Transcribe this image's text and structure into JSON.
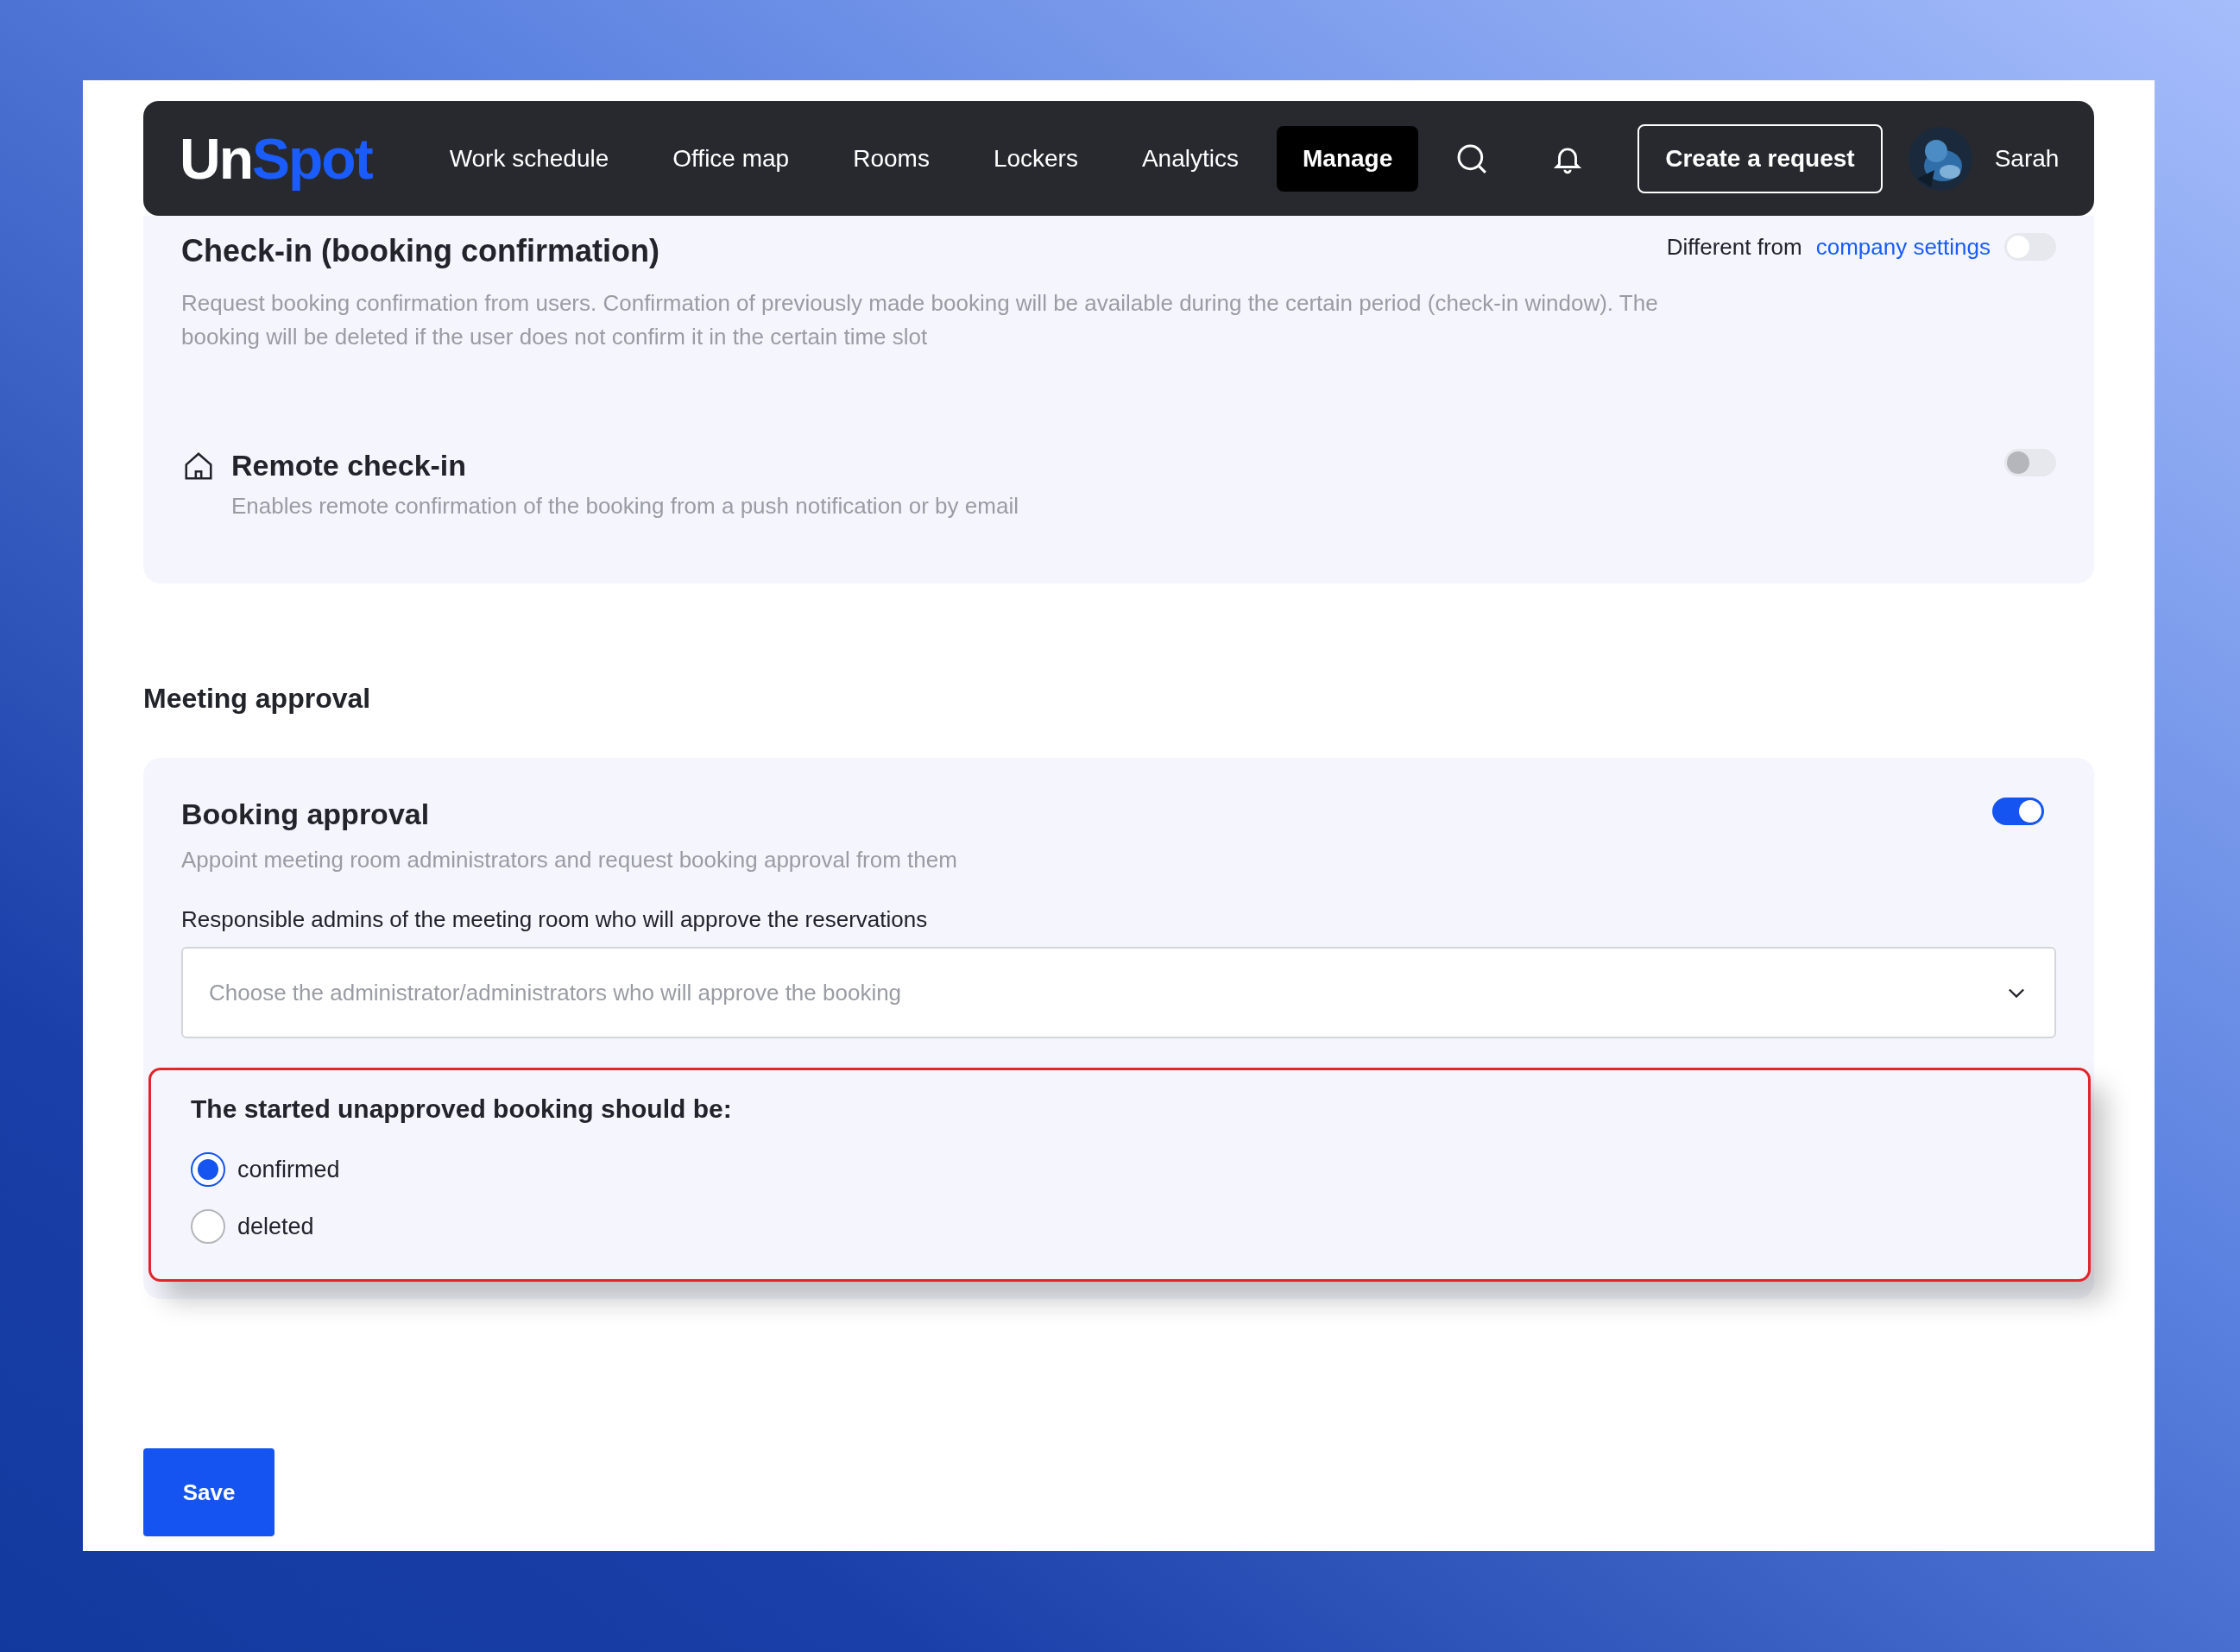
{
  "nav": {
    "logo": {
      "first": "Un",
      "second": "Spot"
    },
    "items": [
      {
        "label": "Work schedule",
        "selected": false
      },
      {
        "label": "Office map",
        "selected": false
      },
      {
        "label": "Rooms",
        "selected": false
      },
      {
        "label": "Lockers",
        "selected": false
      },
      {
        "label": "Analytics",
        "selected": false
      },
      {
        "label": "Manage",
        "selected": true
      }
    ],
    "create_button": "Create a request",
    "user": {
      "name": "Sarah"
    }
  },
  "checkin": {
    "title": "Check-in (booking confirmation)",
    "override_label": "Different from",
    "override_link": "company settings",
    "override_on": false,
    "description": "Request booking confirmation from users. Confirmation of previously made booking will be available during the certain period (check-in window). The booking will be deleted if the user does not confirm it in the certain time slot",
    "remote": {
      "title": "Remote check-in",
      "description": "Enables remote confirmation of the booking from a push notification or by email",
      "on": false,
      "disabled": true
    }
  },
  "meeting_approval": {
    "heading": "Meeting approval",
    "booking_approval": {
      "title": "Booking approval",
      "on": true,
      "description": "Appoint meeting room administrators and request booking approval from them",
      "admins_label": "Responsible admins of the meeting room who will approve the reservations",
      "admins_placeholder": "Choose the administrator/administrators who will approve the booking"
    },
    "unapproved": {
      "title": "The started unapproved booking should be:",
      "options": [
        {
          "label": "confirmed",
          "selected": true
        },
        {
          "label": "deleted",
          "selected": false
        }
      ]
    }
  },
  "save_button": "Save"
}
